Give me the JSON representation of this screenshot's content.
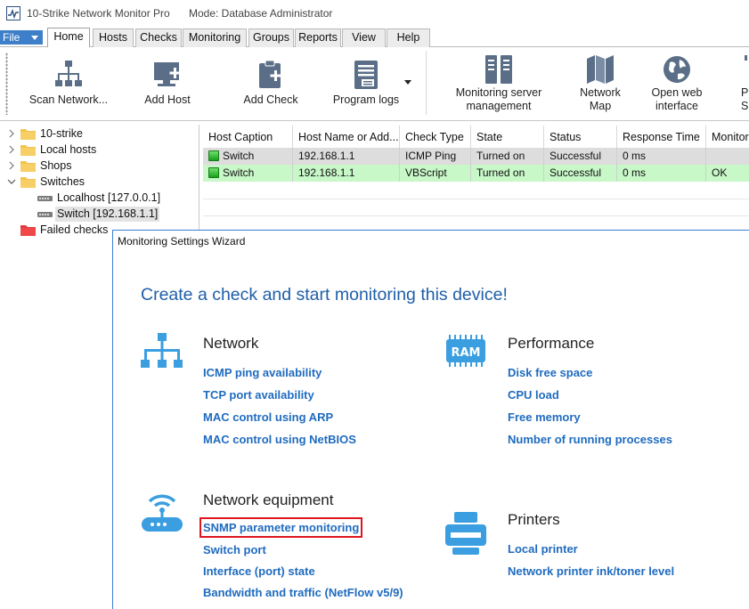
{
  "window": {
    "app_title": "10-Strike Network Monitor Pro",
    "mode": "Mode: Database Administrator"
  },
  "ribbon_tabs": {
    "file": "File",
    "tabs": [
      "Home",
      "Hosts",
      "Checks",
      "Monitoring",
      "Groups",
      "Reports",
      "View",
      "Help"
    ],
    "active": "Home"
  },
  "toolbar": {
    "scan_network": "Scan Network...",
    "add_host": "Add Host",
    "add_check": "Add Check",
    "program_logs": "Program logs",
    "monitoring_server_line1": "Monitoring server",
    "monitoring_server_line2": "management",
    "network_map_line1": "Network",
    "network_map_line2": "Map",
    "web_interface_line1": "Open web",
    "web_interface_line2": "interface",
    "cut_line1": "Pr",
    "cut_line2": "S"
  },
  "tree": {
    "items": [
      {
        "label": "10-strike"
      },
      {
        "label": "Local hosts"
      },
      {
        "label": "Shops"
      },
      {
        "label": "Switches"
      },
      {
        "label": "Localhost [127.0.0.1]"
      },
      {
        "label": "Switch [192.168.1.1]"
      },
      {
        "label": "Failed checks"
      }
    ]
  },
  "grid": {
    "columns": [
      "Host Caption",
      "Host Name or Add...",
      "Check Type",
      "State",
      "Status",
      "Response Time",
      "Monitor"
    ],
    "rows": [
      {
        "caption": "Switch",
        "host": "192.168.1.1",
        "type": "ICMP Ping",
        "state": "Turned on",
        "status": "Successful",
        "response": "0 ms",
        "monitor": ""
      },
      {
        "caption": "Switch",
        "host": "192.168.1.1",
        "type": "VBScript",
        "state": "Turned on",
        "status": "Successful",
        "response": "0 ms",
        "monitor": "OK"
      }
    ],
    "colors": {
      "row1": "#dddddd",
      "row2": "#c8f7c8"
    }
  },
  "wizard": {
    "title": "Monitoring Settings Wizard",
    "headline": "Create a check and start monitoring this device!",
    "network": {
      "title": "Network",
      "links": [
        "ICMP ping availability",
        "TCP port availability",
        "MAC control using ARP",
        "MAC control using NetBIOS"
      ]
    },
    "performance": {
      "title": "Performance",
      "icon_text": "RAM",
      "links": [
        "Disk free space",
        "CPU load",
        "Free memory",
        "Number of running processes"
      ]
    },
    "equipment": {
      "title": "Network equipment",
      "links": [
        "SNMP parameter monitoring",
        "Switch port",
        "Interface (port) state",
        "Bandwidth and traffic (NetFlow v5/9)"
      ]
    },
    "printers": {
      "title": "Printers",
      "links": [
        "Local printer",
        "Network printer ink/toner level"
      ]
    },
    "accent_color": "#1f6bbf",
    "highlight_color": "#e0161e"
  }
}
